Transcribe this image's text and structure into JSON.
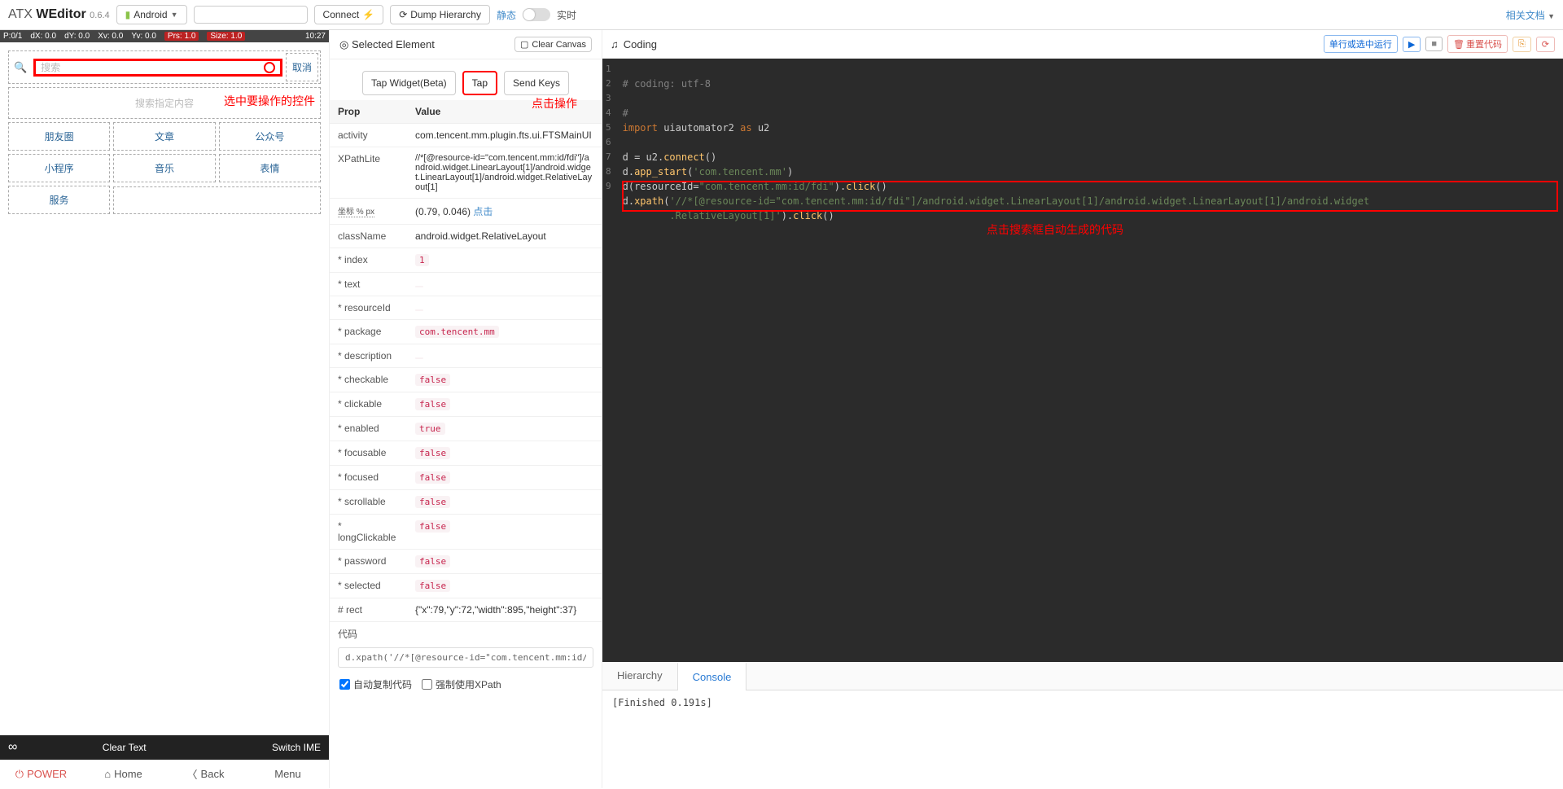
{
  "topbar": {
    "brand_prefix": "ATX ",
    "brand_bold": "WEditor",
    "version": "0.6.4",
    "platform": "Android",
    "addr_placeholder": "",
    "connect": "Connect",
    "dump": "Dump Hierarchy",
    "mode_static": "静态",
    "mode_realtime": "实时",
    "docs": "相关文档"
  },
  "devbar": {
    "items": [
      "P:0/1",
      "dX: 0.0",
      "dY: 0.0",
      "Xv: 0.0",
      "Yv: 0.0",
      "Prs: 1.0",
      "Size: 1.0"
    ],
    "clock": "10:27"
  },
  "screen": {
    "search_placeholder": "搜索",
    "cancel": "取消",
    "hint": "搜索指定内容",
    "buttons_row1": [
      "朋友圈",
      "文章",
      "公众号"
    ],
    "buttons_row2": [
      "小程序",
      "音乐",
      "表情"
    ],
    "buttons_row3": [
      "服务"
    ],
    "anno_select": "选中要操作的控件",
    "anno_tap": "点击操作"
  },
  "devfooter": {
    "clear": "Clear Text",
    "switch_ime": "Switch IME",
    "power": "POWER",
    "home": "Home",
    "back": "Back",
    "menu": "Menu"
  },
  "mid": {
    "header": "Selected Element",
    "clear_canvas": "Clear Canvas",
    "tap_widget": "Tap Widget(Beta)",
    "tap": "Tap",
    "send_keys": "Send Keys",
    "th_prop": "Prop",
    "th_value": "Value",
    "rows": {
      "activity": {
        "k": "activity",
        "v": "com.tencent.mm.plugin.fts.ui.FTSMainUI"
      },
      "xpathlite": {
        "k": "XPathLite",
        "v": "//*[@resource-id=\"com.tencent.mm:id/fdi\"]/android.widget.LinearLayout[1]/android.widget.LinearLayout[1]/android.widget.RelativeLayout[1]"
      },
      "coords": {
        "k": "坐标 % px",
        "v": "(0.79, 0.046) ",
        "link": "点击"
      },
      "className": {
        "k": "className",
        "v": "android.widget.RelativeLayout"
      },
      "index": {
        "k": "* index",
        "v": "1"
      },
      "text": {
        "k": "* text",
        "v": ""
      },
      "resourceId": {
        "k": "* resourceId",
        "v": ""
      },
      "package": {
        "k": "* package",
        "v": "com.tencent.mm"
      },
      "description": {
        "k": "* description",
        "v": ""
      },
      "checkable": {
        "k": "* checkable",
        "v": "false"
      },
      "clickable": {
        "k": "* clickable",
        "v": "false"
      },
      "enabled": {
        "k": "* enabled",
        "v": "true"
      },
      "focusable": {
        "k": "* focusable",
        "v": "false"
      },
      "focused": {
        "k": "* focused",
        "v": "false"
      },
      "scrollable": {
        "k": "* scrollable",
        "v": "false"
      },
      "longClickable": {
        "k": "* longClickable",
        "v": "false"
      },
      "password": {
        "k": "* password",
        "v": "false"
      },
      "selected": {
        "k": "* selected",
        "v": "false"
      },
      "rect": {
        "k": "# rect",
        "v": "{\"x\":79,\"y\":72,\"width\":895,\"height\":37}"
      }
    },
    "code_label": "代码",
    "codeline": "d.xpath('//*[@resource-id=\"com.tencent.mm:id/fdi\"]/android.widget.Lin",
    "cb_auto_copy": "自动复制代码",
    "cb_force_xpath": "强制使用XPath"
  },
  "right": {
    "title": "Coding",
    "run_btn": "单行或选中运行",
    "reset_btn": "重置代码",
    "code": {
      "l1": "# coding: utf-8",
      "l2": "",
      "l3": "#",
      "l4a": "import",
      "l4b": " uiautomator2 ",
      "l4c": "as",
      "l4d": " u2",
      "l5": "",
      "l6a": "d = u2.",
      "l6b": "connect",
      "l6c": "()",
      "l7a": "d.",
      "l7b": "app_start",
      "l7c": "(",
      "l7d": "'com.tencent.mm'",
      "l7e": ")",
      "l8a": "d(resourceId=",
      "l8b": "\"com.tencent.mm:id/fdi\"",
      "l8c": ").",
      "l8d": "click",
      "l8e": "()",
      "l9a": "d.",
      "l9b": "xpath",
      "l9c": "(",
      "l9d": "'//*[@resource-id=\"com.tencent.mm:id/fdi\"]/android.widget.LinearLayout[1]/android.widget.LinearLayout[1]/android.widget",
      "l9e": "        .RelativeLayout[1]'",
      "l9f": ").",
      "l9g": "click",
      "l9h": "()"
    },
    "anno_generated": "点击搜索框自动生成的代码",
    "tab_hierarchy": "Hierarchy",
    "tab_console": "Console",
    "console_text": "[Finished 0.191s]"
  }
}
